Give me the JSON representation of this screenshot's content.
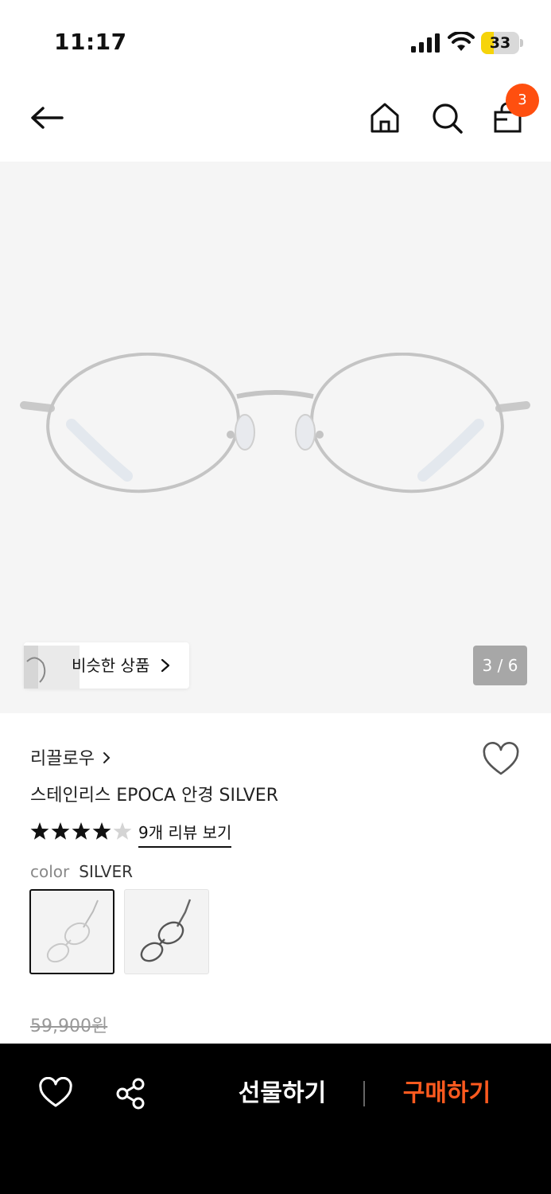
{
  "status_bar": {
    "time": "11:17",
    "battery_level": "33",
    "battery_percent": 33
  },
  "nav": {
    "cart_count": "3",
    "icons": [
      "back-arrow-icon",
      "home-icon",
      "search-icon",
      "shopping-bag-icon"
    ]
  },
  "hero": {
    "similar_label": "비슷한 상품",
    "page_indicator": "3 / 6"
  },
  "product": {
    "brand": "리끌로우",
    "title": "스테인리스 EPOCA 안경 SILVER",
    "rating": 4,
    "rating_max": 5,
    "review_link": "9개 리뷰 보기",
    "color_label": "color",
    "color_value": "SILVER",
    "swatches": [
      "SILVER",
      "dark"
    ],
    "original_price": "59,900원"
  },
  "bottom_bar": {
    "gift_label": "선물하기",
    "buy_label": "구매하기"
  },
  "colors": {
    "accent": "#ff5a1f",
    "badge": "#ff4f0f",
    "bar_bg": "#000000"
  }
}
